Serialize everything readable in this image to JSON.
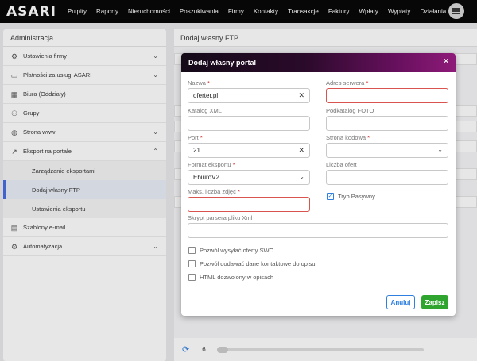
{
  "app": {
    "logo": "ASARI"
  },
  "nav": [
    "Pulpity",
    "Raporty",
    "Nieruchomości",
    "Poszukiwania",
    "Firmy",
    "Kontakty",
    "Transakcje",
    "Faktury",
    "Wpłaty",
    "Wypłaty",
    "Działania"
  ],
  "sidebar": {
    "title": "Administracja",
    "items": [
      {
        "label": "Ustawienia firmy",
        "icon": "gear-icon"
      },
      {
        "label": "Płatności za usługi ASARI",
        "icon": "card-icon"
      },
      {
        "label": "Biura (Oddziały)",
        "icon": "building-icon"
      },
      {
        "label": "Grupy",
        "icon": "users-icon"
      },
      {
        "label": "Strona www",
        "icon": "globe-icon"
      },
      {
        "label": "Eksport na portale",
        "icon": "export-icon"
      }
    ],
    "subitems": [
      "Zarządzanie eksportami",
      "Dodaj własny FTP",
      "Ustawienia eksportu"
    ],
    "items_after": [
      {
        "label": "Szablony e-mail",
        "icon": "template-icon"
      },
      {
        "label": "Automatyzacja",
        "icon": "automation-icon"
      }
    ]
  },
  "main": {
    "title": "Dodaj własny FTP",
    "page_number": "6"
  },
  "modal": {
    "title": "Dodaj własny portal",
    "close": "×",
    "fields": {
      "name": {
        "label": "Nazwa",
        "value": "oferter.pl"
      },
      "server": {
        "label": "Adres serwera",
        "value": ""
      },
      "xml_dir": {
        "label": "Katalog XML",
        "value": ""
      },
      "photo_dir": {
        "label": "Podkatalog FOTO",
        "value": ""
      },
      "port": {
        "label": "Port",
        "value": "21"
      },
      "charset": {
        "label": "Strona kodowa",
        "value": ""
      },
      "export_format": {
        "label": "Format eksportu",
        "value": "EbiuroV2"
      },
      "offer_count": {
        "label": "Liczba ofert",
        "value": ""
      },
      "max_photos": {
        "label": "Maks. liczba zdjęć",
        "value": ""
      },
      "passive": {
        "label": "Tryb Pasywny"
      },
      "parser_script": {
        "label": "Skrypt parsera pliku Xml",
        "value": ""
      }
    },
    "required_mark": "*",
    "checkboxes": [
      {
        "label": "Pozwól wysyłać oferty SWO"
      },
      {
        "label": "Pozwól dodawać dane kontaktowe do opisu"
      },
      {
        "label": "HTML dozwolony w opisach"
      }
    ],
    "cancel_label": "Anuluj",
    "save_label": "Zapisz"
  },
  "colors": {
    "accent": "#2f7fe0",
    "save": "#2fa52f",
    "error": "#d9534f"
  }
}
